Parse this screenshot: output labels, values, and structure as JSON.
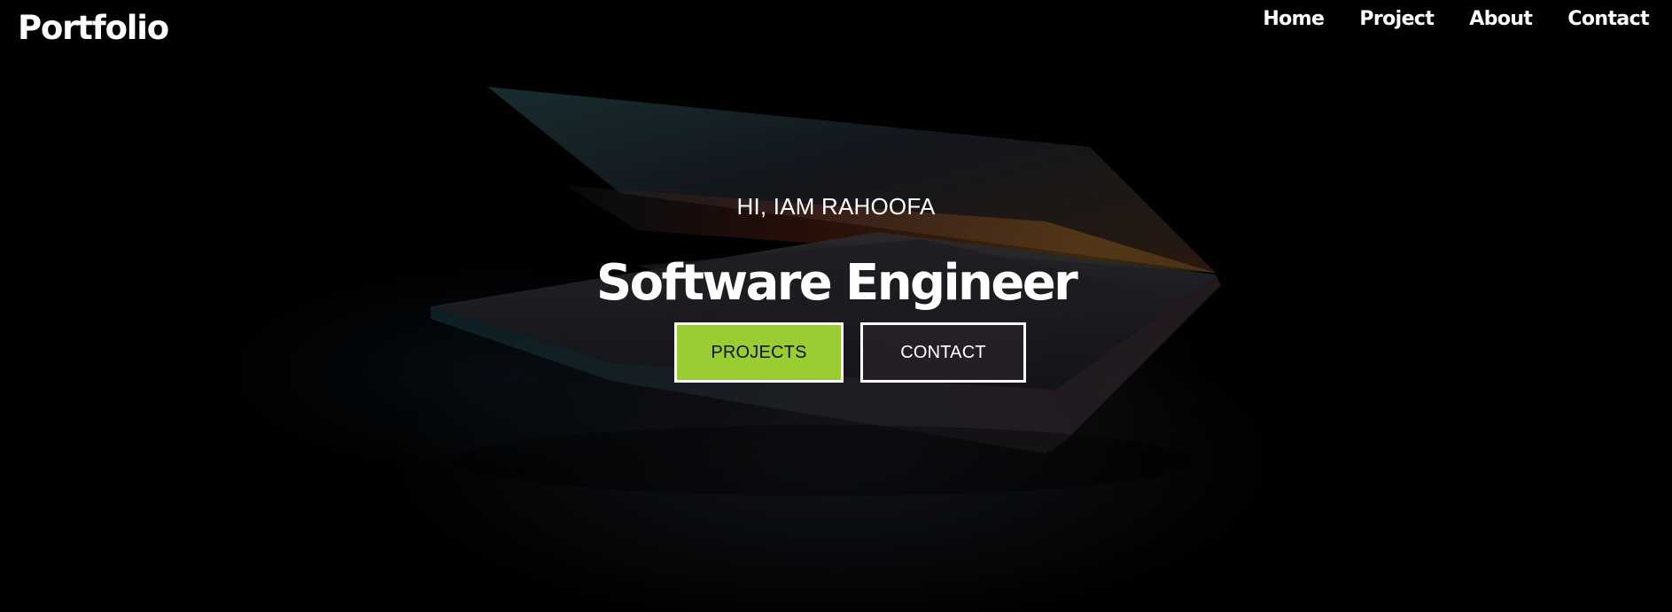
{
  "header": {
    "logo": "Portfolio",
    "nav": [
      "Home",
      "Project",
      "About",
      "Contact"
    ]
  },
  "hero": {
    "greeting": "HI, IAM RAHOOFA",
    "title": "Software Engineer",
    "buttons": {
      "primary": "PROJECTS",
      "secondary": "CONTACT"
    }
  },
  "colors": {
    "background": "#020203",
    "accent": "#9acd32",
    "text": "#ffffff"
  }
}
